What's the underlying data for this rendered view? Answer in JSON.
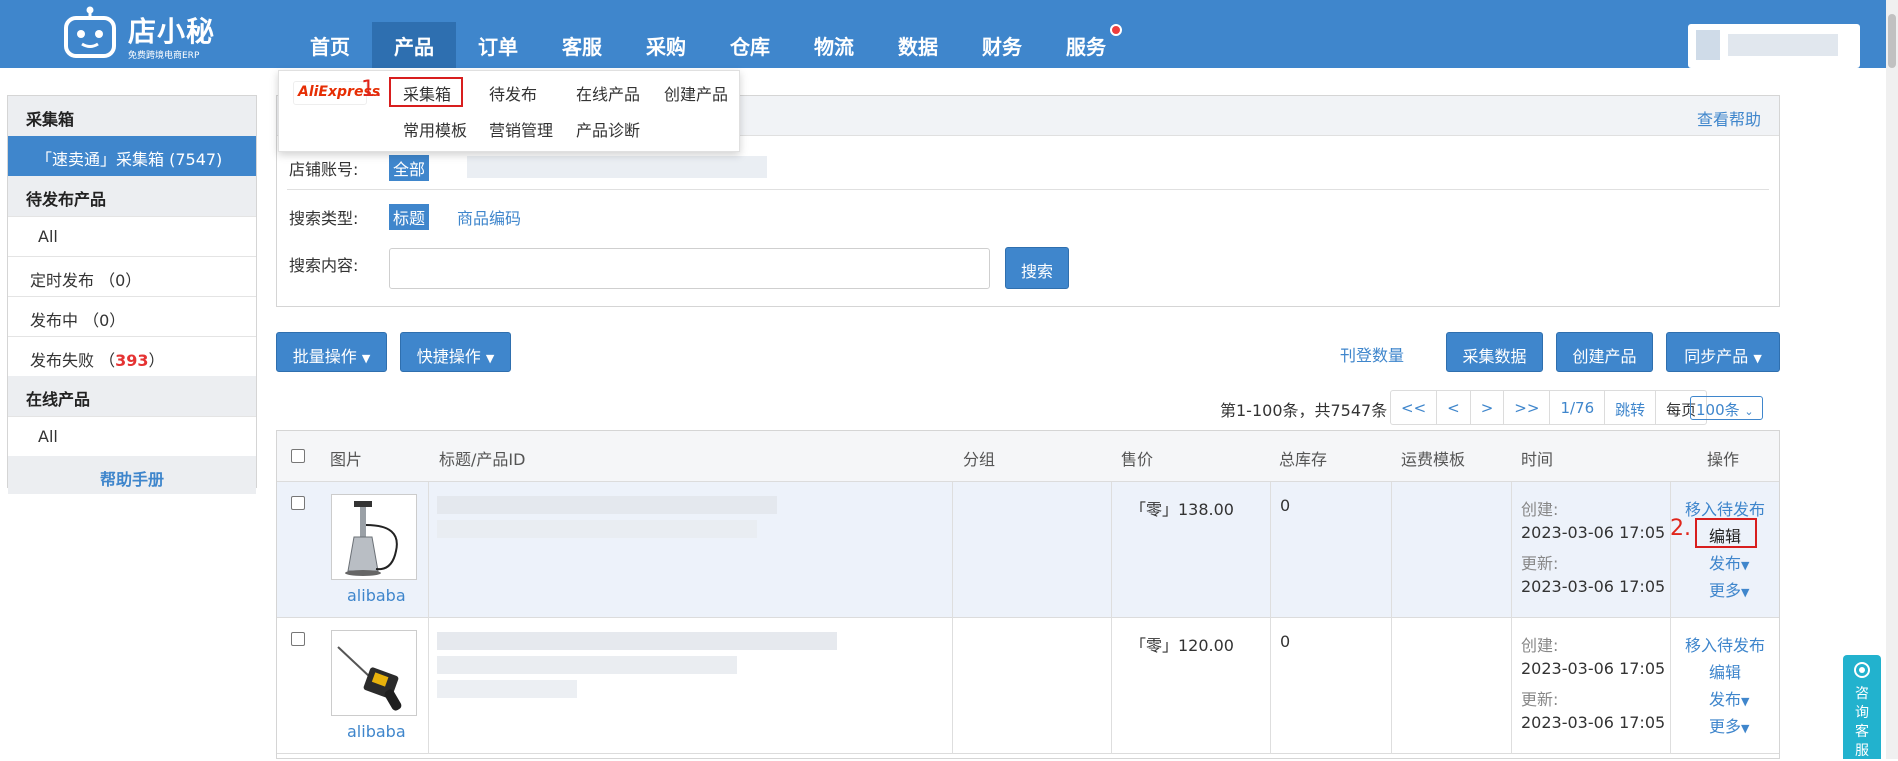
{
  "brand": {
    "name": "店小秘",
    "tagline": "免费跨境电商ERP"
  },
  "nav": [
    "首页",
    "产品",
    "订单",
    "客服",
    "采购",
    "仓库",
    "物流",
    "数据",
    "财务",
    "服务"
  ],
  "nav_active": "产品",
  "dropdown": {
    "logo_text": "AliExpress",
    "items_row1": [
      "采集箱",
      "待发布",
      "在线产品",
      "创建产品"
    ],
    "items_row2": [
      "常用模板",
      "营销管理",
      "产品诊断"
    ],
    "step1": "1.",
    "step2": "2."
  },
  "sidebar": {
    "sec1": "采集箱",
    "active_item": "「速卖通」采集箱 (7547)",
    "sec2": "待发布产品",
    "all1": "All",
    "scheduled": "定时发布 （0）",
    "publishing": "发布中 （0）",
    "failed_label": "发布失败 （",
    "failed_count": "393",
    "failed_close": "）",
    "sec3": "在线产品",
    "all2": "All",
    "help": "帮助手册"
  },
  "filter": {
    "help": "查看帮助",
    "store_label": "店铺账号:",
    "store_all": "全部",
    "type_label": "搜索类型:",
    "type_title": "标题",
    "type_sku": "商品编码",
    "content_label": "搜索内容:",
    "search_value": "",
    "search_btn": "搜索"
  },
  "actions": {
    "batch": "批量操作",
    "quick": "快捷操作",
    "count_link": "刊登数量",
    "collect": "采集数据",
    "create": "创建产品",
    "sync": "同步产品"
  },
  "pager": {
    "summary": "第1-100条，共7547条",
    "first": "<<",
    "prev": "<",
    "next": ">",
    "last": ">>",
    "page": "1/76",
    "jump": "跳转",
    "per_label": "每页",
    "per_value": "100条"
  },
  "table": {
    "headers": [
      "图片",
      "标题/产品ID",
      "分组",
      "售价",
      "总库存",
      "运费模板",
      "时间",
      "操作"
    ],
    "rows": [
      {
        "source": "alibaba",
        "price": "「零」138.00",
        "stock": "0",
        "created_label": "创建:",
        "created": "2023-03-06 17:05",
        "updated_label": "更新:",
        "updated": "2023-03-06 17:05",
        "ops": [
          "移入待发布",
          "编辑",
          "发布",
          "更多"
        ]
      },
      {
        "source": "alibaba",
        "price": "「零」120.00",
        "stock": "0",
        "created_label": "创建:",
        "created": "2023-03-06 17:05",
        "updated_label": "更新:",
        "updated": "2023-03-06 17:05",
        "ops": [
          "移入待发布",
          "编辑",
          "发布",
          "更多"
        ]
      }
    ]
  },
  "chat": "咨询客服",
  "colors": {
    "primary": "#3f86cc",
    "danger": "#e53333",
    "chat": "#22b2ce"
  }
}
